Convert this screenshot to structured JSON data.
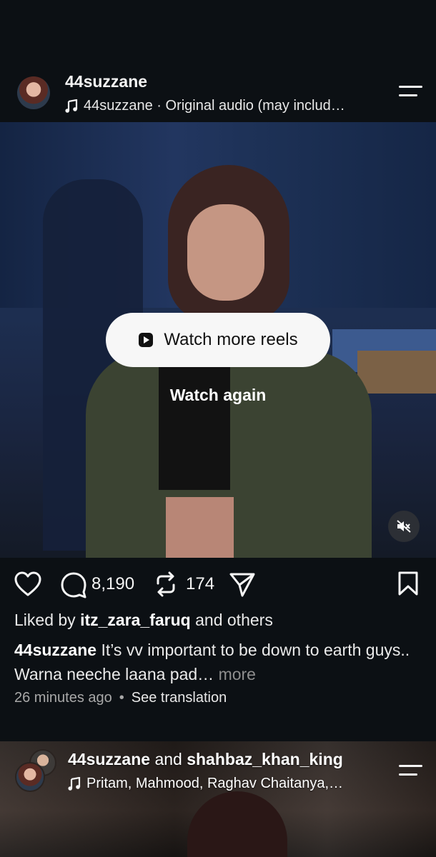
{
  "post": {
    "username": "44suzzane",
    "audio_text": "44suzzane · Original audio (may includ…",
    "overlay": {
      "watch_more_label": "Watch more reels",
      "watch_again_label": "Watch again"
    },
    "actions": {
      "comments_count": "8,190",
      "reposts_count": "174"
    },
    "likes": {
      "prefix": "Liked by",
      "user": "itz_zara_faruq",
      "suffix": "and others"
    },
    "caption": {
      "username": "44suzzane",
      "text": "It’s vv important to be down to earth guys.. Warna neeche laana pad…",
      "more_label": "more"
    },
    "time": "26 minutes ago",
    "separator": "•",
    "see_translation": "See translation"
  },
  "next_post": {
    "user1": "44suzzane",
    "joiner": "and",
    "user2": "shahbaz_khan_king",
    "audio_text": "Pritam, Mahmood, Raghav Chaitanya,…"
  },
  "colors": {
    "background": "#0c1014",
    "pill": "#f7f7f7",
    "muted_text": "#a8a8a8"
  },
  "icons": [
    "music-note-icon",
    "menu-icon",
    "reel-play-icon",
    "mute-icon",
    "heart-icon",
    "comment-icon",
    "repost-icon",
    "share-icon",
    "bookmark-icon"
  ]
}
